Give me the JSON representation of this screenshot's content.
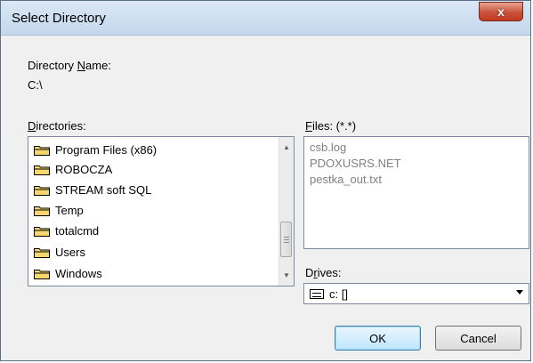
{
  "window": {
    "title": "Select Directory",
    "close_glyph": "x"
  },
  "directory_name": {
    "label_prefix": "Directory ",
    "label_accel": "N",
    "label_suffix": "ame:",
    "value": "C:\\"
  },
  "directories": {
    "label_accel": "D",
    "label_suffix": "irectories:",
    "items": [
      "Program Files (x86)",
      "ROBOCZA",
      "STREAM soft SQL",
      "Temp",
      "totalcmd",
      "Users",
      "Windows"
    ]
  },
  "files": {
    "label_accel": "F",
    "label_suffix": "iles: (*.*)",
    "items": [
      "csb.log",
      "PDOXUSRS.NET",
      "pestka_out.txt"
    ]
  },
  "drives": {
    "label_prefix": "D",
    "label_accel": "r",
    "label_suffix": "ives:",
    "value": "c: []",
    "icon": "drive-icon"
  },
  "buttons": {
    "ok_label": "OK",
    "cancel_label": "Cancel"
  },
  "colors": {
    "folder": "#f5d76e",
    "default_button_border": "#3c7fb1",
    "close_button": "#c9523b"
  }
}
